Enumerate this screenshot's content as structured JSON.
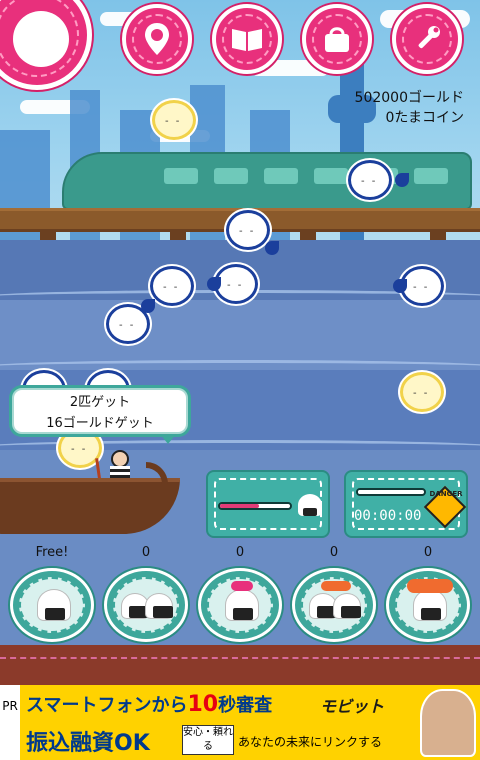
{
  "stats": {
    "gold": "502000ゴールド",
    "coins": "0たまコイン"
  },
  "topbar": {
    "main_icon": "fish-face-icon",
    "buttons": [
      {
        "icon": "map-pin-icon"
      },
      {
        "icon": "book-icon"
      },
      {
        "icon": "bag-icon"
      },
      {
        "icon": "wrench-icon"
      }
    ]
  },
  "bubble": {
    "line1": "2匹ゲット",
    "line2": "16ゴールドゲット"
  },
  "panels": {
    "left": {
      "progress": 0.55,
      "fill_color": "#e23b77"
    },
    "right": {
      "timer": "00:00:00",
      "danger_label": "DANGER",
      "progress": 0.95
    }
  },
  "slots": [
    {
      "count": "Free!"
    },
    {
      "count": "0"
    },
    {
      "count": "0"
    },
    {
      "count": "0"
    },
    {
      "count": "0"
    }
  ],
  "ad": {
    "pr": "PR",
    "line1a": "スマートフォンから",
    "line1b": "10",
    "line1c": "秒審査",
    "brand": "モビット",
    "line2": "振込融資OK",
    "badge": "安心・頼れる",
    "tagline": "あなたの未来にリンクする"
  }
}
